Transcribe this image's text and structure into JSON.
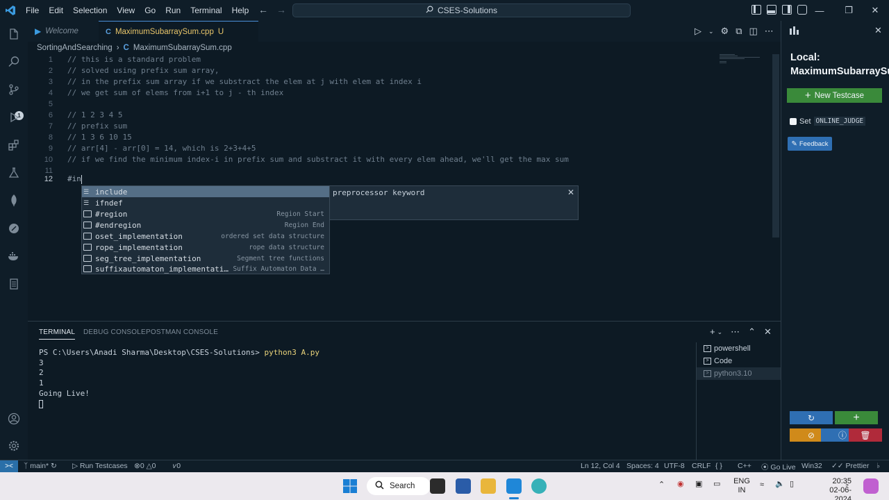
{
  "menu": [
    "File",
    "Edit",
    "Selection",
    "View",
    "Go",
    "Run",
    "Terminal",
    "Help"
  ],
  "command_center": "CSES-Solutions",
  "tabs": {
    "welcome": "Welcome",
    "active": "MaximumSubarraySum.cpp",
    "active_status": "U"
  },
  "breadcrumb": {
    "folder": "SortingAndSearching",
    "file": "MaximumSubarraySum.cpp"
  },
  "code_lines": [
    {
      "n": "1",
      "text": "// this is a standard problem"
    },
    {
      "n": "2",
      "text": "// solved using prefix sum array,"
    },
    {
      "n": "3",
      "text": "// in the prefix sum array if we substract the elem at j with elem at index i"
    },
    {
      "n": "4",
      "text": "// we get sum of elems from i+1 to j - th index"
    },
    {
      "n": "5",
      "text": ""
    },
    {
      "n": "6",
      "text": "// 1 2 3 4 5"
    },
    {
      "n": "7",
      "text": "// prefix sum"
    },
    {
      "n": "8",
      "text": "// 1 3 6 10 15"
    },
    {
      "n": "9",
      "text": "// arr[4] - arr[0] = 14, which is 2+3+4+5"
    },
    {
      "n": "10",
      "text": "// if we find the minimum index-i in prefix sum and substract it with every elem ahead, we'll get the max sum"
    },
    {
      "n": "11",
      "text": ""
    },
    {
      "n": "12",
      "text": "#in"
    }
  ],
  "suggestions": [
    {
      "label": "include",
      "detail": ""
    },
    {
      "label": "ifndef",
      "detail": ""
    },
    {
      "label": "#region",
      "detail": "Region Start"
    },
    {
      "label": "#endregion",
      "detail": "Region End"
    },
    {
      "label": "oset_implementation",
      "detail": "ordered set data structure"
    },
    {
      "label": "rope_implementation",
      "detail": "rope data structure"
    },
    {
      "label": "seg_tree_implementation",
      "detail": "Segment tree functions"
    },
    {
      "label": "suffixautomaton_implementati…",
      "detail": "Suffix Automaton Data …"
    }
  ],
  "suggest_details": "preprocessor keyword",
  "panel": {
    "tabs": [
      "TERMINAL",
      "DEBUG CONSOLE",
      "POSTMAN CONSOLE"
    ],
    "prompt": "PS C:\\Users\\Anadi Sharma\\Desktop\\CSES-Solutions> ",
    "command": "python3 A.py",
    "output": [
      "3",
      "2",
      "1",
      "Going Live!"
    ],
    "terminals": [
      "powershell",
      "Code",
      "python3.10"
    ]
  },
  "sidepanel": {
    "title_line1": "Local:",
    "title_line2": "MaximumSubarraySum",
    "new_testcase": "New Testcase",
    "set_label": "Set",
    "online_judge": "ONLINE_JUDGE",
    "feedback": "Feedback"
  },
  "status": {
    "branch": "main*",
    "run_testcases": "Run Testcases",
    "errors": "0",
    "warnings": "0",
    "ports": "0",
    "position": "Ln 12, Col 4",
    "spaces": "Spaces: 4",
    "encoding": "UTF-8",
    "eol": "CRLF",
    "language": "C++",
    "go_live": "Go Live",
    "platform": "Win32",
    "prettier": "Prettier"
  },
  "taskbar": {
    "search": "Search",
    "lang_line1": "ENG",
    "lang_line2": "IN",
    "time": "20:35",
    "date": "02-06-2024"
  },
  "colors": {
    "accent": "#2a6fa8",
    "testcase_green": "#3a8a3a",
    "rerun_blue": "#2f6fb3",
    "stop_orange": "#d08a1a",
    "delete_red": "#b02a3a"
  }
}
